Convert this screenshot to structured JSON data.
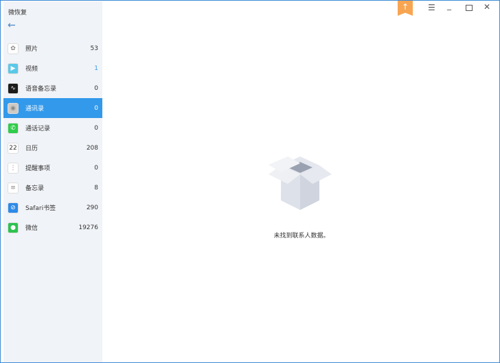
{
  "app_title": "微恢复",
  "sidebar": {
    "items": [
      {
        "label": "照片",
        "count": "53",
        "icon": "photos-icon",
        "color": "#fff"
      },
      {
        "label": "视频",
        "count": "1",
        "icon": "video-icon",
        "color": "#5bc8e8"
      },
      {
        "label": "语音备忘录",
        "count": "0",
        "icon": "voice-memo-icon",
        "color": "#1c1c1c"
      },
      {
        "label": "通讯录",
        "count": "0",
        "icon": "contacts-icon",
        "color": "#cfcac4"
      },
      {
        "label": "通话记录",
        "count": "0",
        "icon": "phone-icon",
        "color": "#2ecc4a"
      },
      {
        "label": "日历",
        "count": "208",
        "icon": "calendar-icon",
        "color": "#fff"
      },
      {
        "label": "提醒事项",
        "count": "0",
        "icon": "reminders-icon",
        "color": "#fff"
      },
      {
        "label": "备忘录",
        "count": "8",
        "icon": "notes-icon",
        "color": "#fff"
      },
      {
        "label": "Safari书签",
        "count": "290",
        "icon": "safari-icon",
        "color": "#2d8ae8"
      },
      {
        "label": "微信",
        "count": "19276",
        "icon": "wechat-icon",
        "color": "#2dc24e"
      }
    ],
    "selected": 3,
    "calendar_day": "22"
  },
  "empty_message": "未找到联系人数据。",
  "accent": "#3399ea"
}
